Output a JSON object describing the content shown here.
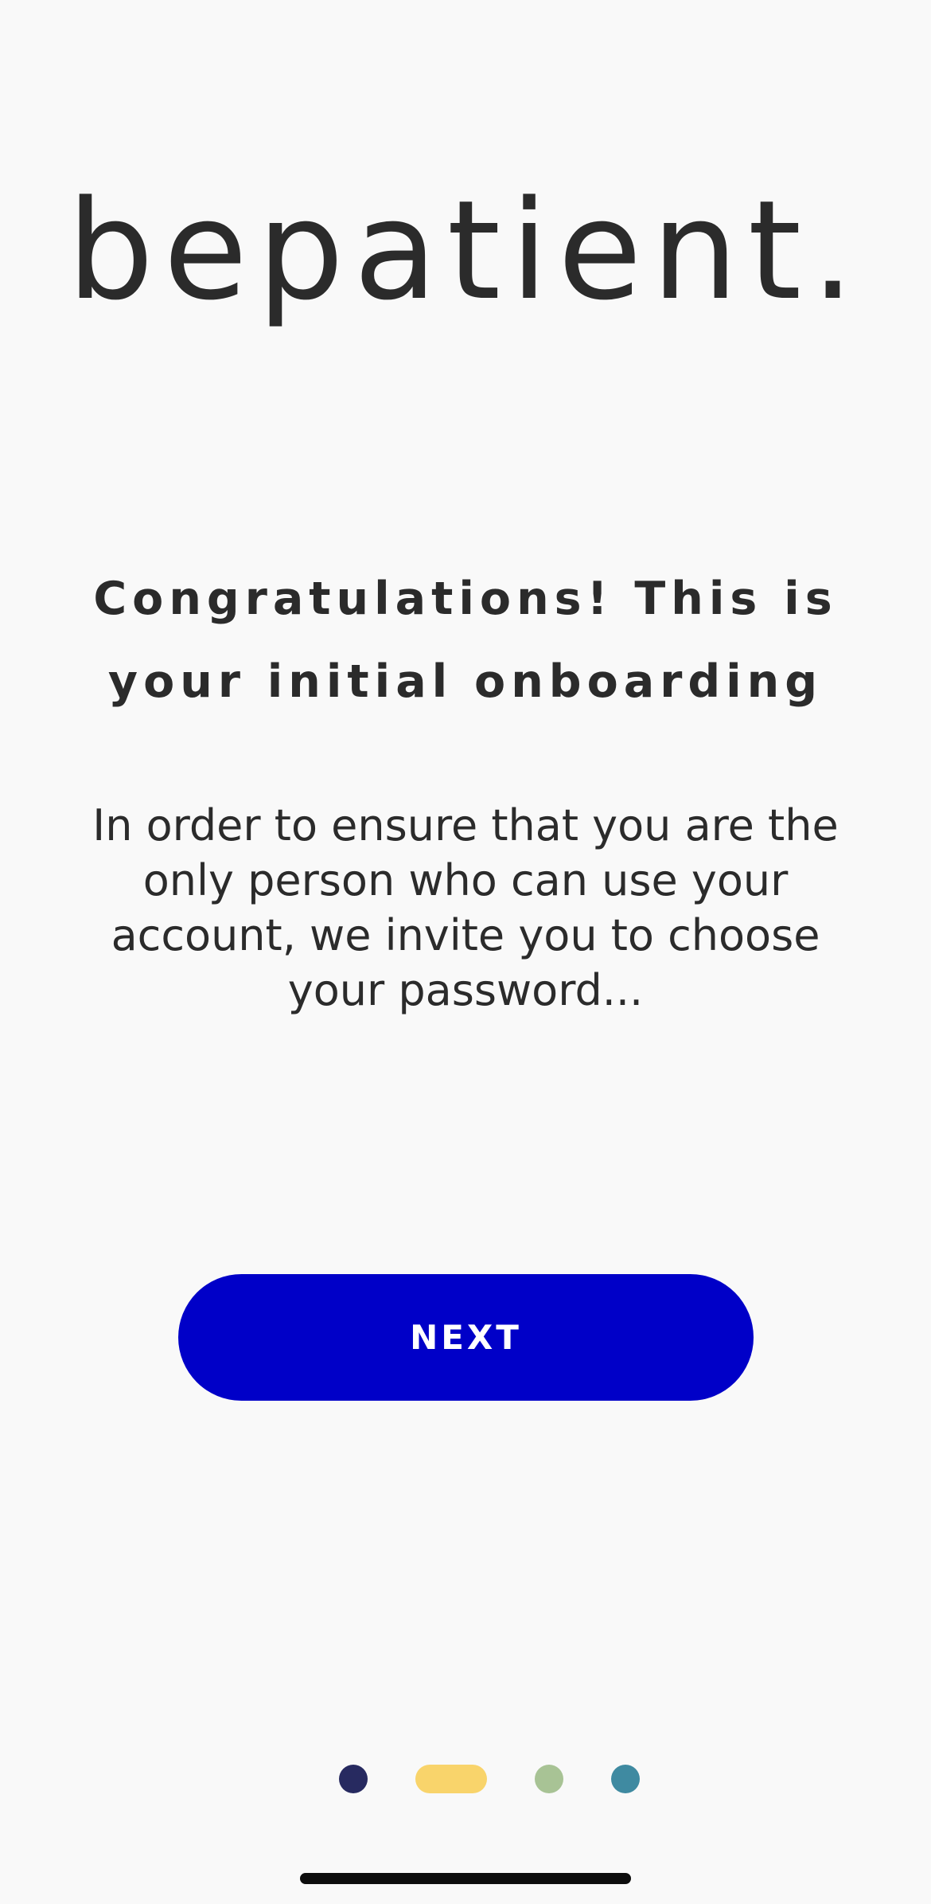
{
  "logo": {
    "text": "bepatient."
  },
  "onboarding": {
    "headline": "Congratulations! This is your initial onboarding",
    "body": "In order to ensure that you are the only person who can use your account, we invite you to choose your password..."
  },
  "actions": {
    "next_label": "NEXT"
  },
  "pager": {
    "page_count": 4,
    "active_index": 1,
    "dot_colors": [
      "#272a60",
      "#f9d46b",
      "#a8c395",
      "#3f8aa1"
    ]
  },
  "colors": {
    "background": "#f9f9f9",
    "text": "#2b2b2b",
    "primary_button": "#0000c8"
  }
}
